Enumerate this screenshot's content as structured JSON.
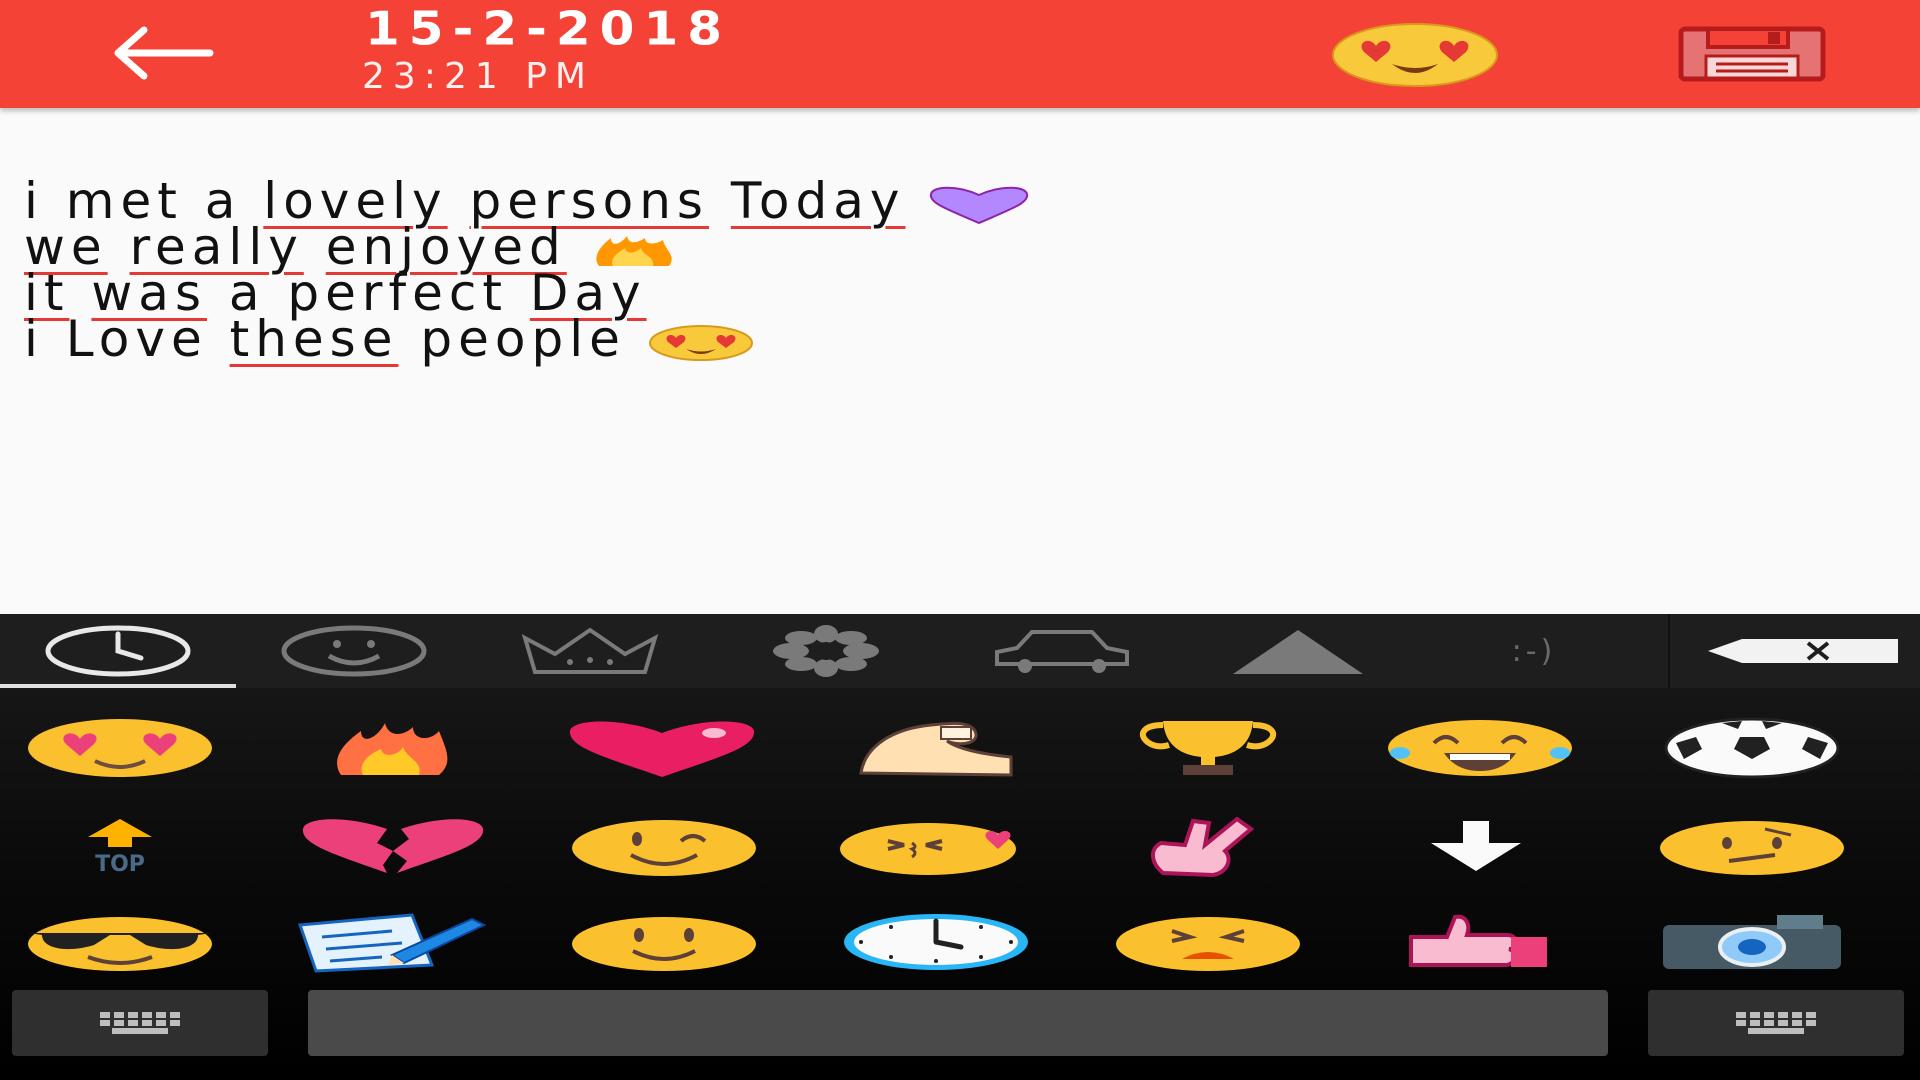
{
  "header": {
    "date": "15-2-2018",
    "time": "23:21 PM",
    "back_icon": "arrow-left-icon",
    "mood_icon": "heart-eyes-emoji",
    "save_icon": "floppy-disk-icon",
    "bar_color": "#f44336"
  },
  "note": {
    "line1": [
      "i met a ",
      "lovely",
      " ",
      "persons",
      " ",
      "Today",
      " "
    ],
    "line1_emoji": "purple-heart",
    "line2": [
      "we",
      " ",
      "really",
      " ",
      "enjoyed",
      " "
    ],
    "line2_emoji": "fire",
    "line3": [
      "it",
      " ",
      "was",
      " a perfect ",
      "Day"
    ],
    "line4": [
      "i Love ",
      "these",
      " people "
    ],
    "line4_emoji": "heart-eyes"
  },
  "keyboard": {
    "categories": [
      "recent-clock-icon",
      "smiley-icon",
      "crown-icon",
      "flower-icon",
      "car-icon",
      "triangle-icon",
      "emoticon-text"
    ],
    "emoticon_label": ":-)",
    "backspace_icon": "backspace-icon",
    "emojis": [
      "heart-eyes",
      "fire",
      "pink-heart",
      "flexed-biceps",
      "trophy",
      "tears-of-joy",
      "soccer-ball",
      "top-arrow",
      "broken-heart",
      "winking-face",
      "kissing-heart",
      "victory-hand",
      "down-arrow",
      "confused-face",
      "sunglasses-face",
      "memo",
      "smiling-face",
      "clock",
      "persevering-face",
      "thumbs-up",
      "camera"
    ],
    "top_label": "TOP",
    "bottom_left_icon": "keyboard-icon",
    "bottom_right_icon": "keyboard-icon"
  }
}
